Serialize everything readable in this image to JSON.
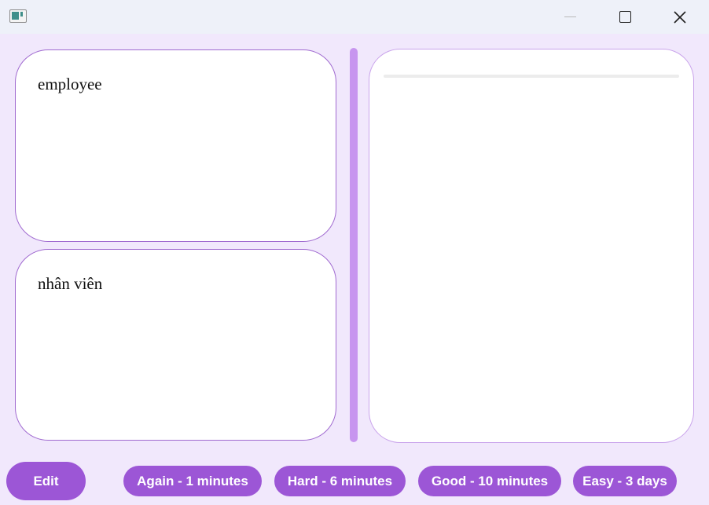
{
  "window": {
    "icon": "app-window-icon",
    "controls": [
      "minimize-icon",
      "maximize-icon",
      "close-icon"
    ]
  },
  "card": {
    "front": "employee",
    "back": "nhân viên"
  },
  "actions": {
    "edit": "Edit",
    "again": "Again - 1 minutes",
    "hard": "Hard - 6 minutes",
    "good": "Good - 10 minutes",
    "easy": "Easy - 3 days"
  },
  "colors": {
    "background": "#f1e8fc",
    "accent": "#9c56d6",
    "card_border": "#a06ad0",
    "splitter": "#c795ef"
  }
}
